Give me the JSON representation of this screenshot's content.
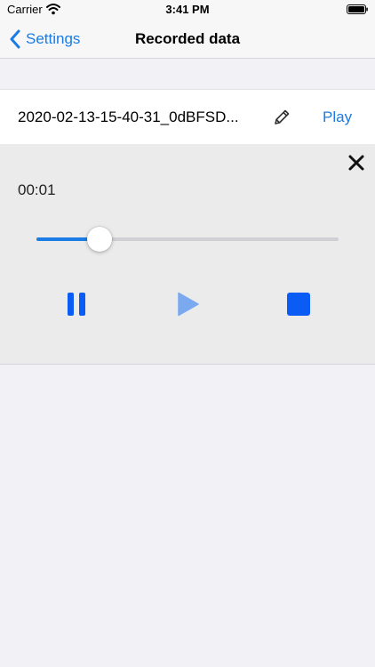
{
  "status_bar": {
    "carrier": "Carrier",
    "time": "3:41 PM"
  },
  "nav": {
    "back_label": "Settings",
    "title": "Recorded data"
  },
  "recording": {
    "file_name": "2020-02-13-15-40-31_0dBFSD...",
    "play_label": "Play"
  },
  "player": {
    "elapsed": "00:01",
    "progress": 0.21
  },
  "colors": {
    "accent": "#1a7ce4",
    "control_blue": "#0a5cf5",
    "play_disabled": "#7aa9f0"
  },
  "icons": [
    "wifi-icon",
    "battery-icon",
    "chevron-left-icon",
    "pencil-icon",
    "close-icon",
    "pause-icon",
    "play-icon",
    "stop-icon"
  ]
}
